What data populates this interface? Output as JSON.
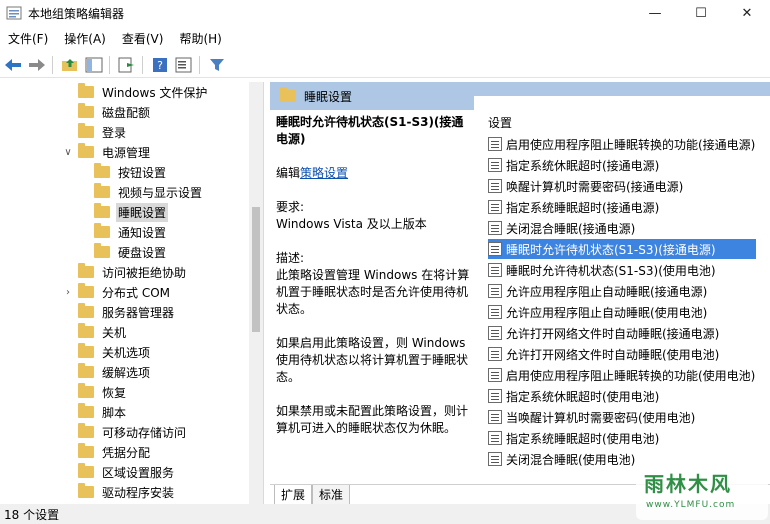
{
  "window": {
    "title": "本地组策略编辑器",
    "controls": [
      "—",
      "☐",
      "✕"
    ]
  },
  "menu": [
    "文件(F)",
    "操作(A)",
    "查看(V)",
    "帮助(H)"
  ],
  "tree": {
    "items": [
      {
        "label": "Windows 文件保护",
        "indent": 4,
        "expander": ""
      },
      {
        "label": "磁盘配额",
        "indent": 4,
        "expander": ""
      },
      {
        "label": "登录",
        "indent": 4,
        "expander": ""
      },
      {
        "label": "电源管理",
        "indent": 4,
        "expander": "∨"
      },
      {
        "label": "按钮设置",
        "indent": 5,
        "expander": ""
      },
      {
        "label": "视频与显示设置",
        "indent": 5,
        "expander": ""
      },
      {
        "label": "睡眠设置",
        "indent": 5,
        "expander": "",
        "selected": true
      },
      {
        "label": "通知设置",
        "indent": 5,
        "expander": ""
      },
      {
        "label": "硬盘设置",
        "indent": 5,
        "expander": ""
      },
      {
        "label": "访问被拒绝协助",
        "indent": 4,
        "expander": ""
      },
      {
        "label": "分布式 COM",
        "indent": 4,
        "expander": "›"
      },
      {
        "label": "服务器管理器",
        "indent": 4,
        "expander": ""
      },
      {
        "label": "关机",
        "indent": 4,
        "expander": ""
      },
      {
        "label": "关机选项",
        "indent": 4,
        "expander": ""
      },
      {
        "label": "缓解选项",
        "indent": 4,
        "expander": ""
      },
      {
        "label": "恢复",
        "indent": 4,
        "expander": ""
      },
      {
        "label": "脚本",
        "indent": 4,
        "expander": ""
      },
      {
        "label": "可移动存储访问",
        "indent": 4,
        "expander": ""
      },
      {
        "label": "凭据分配",
        "indent": 4,
        "expander": ""
      },
      {
        "label": "区域设置服务",
        "indent": 4,
        "expander": ""
      },
      {
        "label": "驱动程序安装",
        "indent": 4,
        "expander": ""
      }
    ]
  },
  "right_pane": {
    "header": "睡眠设置",
    "description": {
      "title": "睡眠时允许待机状态(S1-S3)(接通电源)",
      "edit_prefix": "编辑",
      "edit_link": "策略设置",
      "requirements_label": "要求:",
      "requirements_value": "Windows Vista 及以上版本",
      "desc_label": "描述:",
      "desc_p1": "此策略设置管理 Windows 在将计算机置于睡眠状态时是否允许使用待机状态。",
      "desc_p2": "如果启用此策略设置，则 Windows 使用待机状态以将计算机置于睡眠状态。",
      "desc_p3": "如果禁用或未配置此策略设置，则计算机可进入的睡眠状态仅为休眠。"
    },
    "settings_header": "设置",
    "settings": [
      "启用使应用程序阻止睡眠转换的功能(接通电源)",
      "指定系统休眠超时(接通电源)",
      "唤醒计算机时需要密码(接通电源)",
      "指定系统睡眠超时(接通电源)",
      "关闭混合睡眠(接通电源)",
      "睡眠时允许待机状态(S1-S3)(接通电源)",
      "睡眠时允许待机状态(S1-S3)(使用电池)",
      "允许应用程序阻止自动睡眠(接通电源)",
      "允许应用程序阻止自动睡眠(使用电池)",
      "允许打开网络文件时自动睡眠(接通电源)",
      "允许打开网络文件时自动睡眠(使用电池)",
      "启用使应用程序阻止睡眠转换的功能(使用电池)",
      "指定系统休眠超时(使用电池)",
      "当唤醒计算机时需要密码(使用电池)",
      "指定系统睡眠超时(使用电池)",
      "关闭混合睡眠(使用电池)"
    ],
    "selected_index": 5,
    "tabs": [
      "扩展",
      "标准"
    ]
  },
  "status": "18 个设置",
  "watermark": {
    "text": "雨林木风",
    "url": "www.YLMFU.com"
  },
  "colors": {
    "header_bg": "#adc7e4",
    "selection": "#3d83e0",
    "folder": "#e8c15a",
    "link": "#0b4faf"
  }
}
